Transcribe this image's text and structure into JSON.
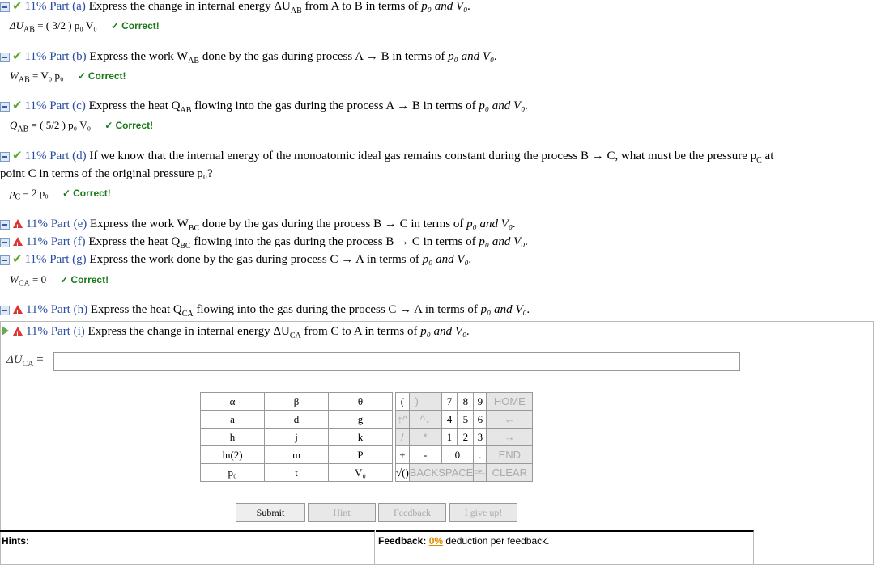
{
  "parts": [
    {
      "pct": "11% Part (a)",
      "question": "Express the change in internal energy ΔU",
      "sub": "AB",
      "question2": " from A to B in terms of ",
      "status": "correct",
      "answer_lhs": "ΔU",
      "answer_sub": "AB",
      "answer_rhs": " = ( 3/2 ) p₀ V₀",
      "feedback": "Correct!"
    },
    {
      "pct": "11% Part (b)",
      "question": "Express the work W",
      "sub": "AB",
      "question2": " done by the gas during process A → B in terms of ",
      "status": "correct",
      "answer_lhs": "W",
      "answer_sub": "AB",
      "answer_rhs": " = V₀ p₀",
      "feedback": "Correct!"
    },
    {
      "pct": "11% Part (c)",
      "question": "Express the heat Q",
      "sub": "AB",
      "question2": " flowing into the gas during the process A → B in terms of ",
      "status": "correct",
      "answer_lhs": "Q",
      "answer_sub": "AB",
      "answer_rhs": " = ( 5/2 ) p₀ V₀",
      "feedback": "Correct!"
    },
    {
      "pct": "11% Part (d)",
      "question": "If we know that the internal energy of the monoatomic ideal gas remains constant during the process B → C, what must be the pressure p",
      "sub": "C",
      "question2": " at",
      "line2": "point C in terms of the original pressure p₀?",
      "status": "correct",
      "answer_lhs": "p",
      "answer_sub": "C",
      "answer_rhs": " = 2 p₀",
      "feedback": "Correct!"
    },
    {
      "pct": "11% Part (e)",
      "question": "Express the work W",
      "sub": "BC",
      "question2": " done by the gas during the process B → C in terms of ",
      "status": "warn"
    },
    {
      "pct": "11% Part (f)",
      "question": "Express the heat Q",
      "sub": "BC",
      "question2": " flowing into the gas during the process B → C in terms of ",
      "status": "warn"
    },
    {
      "pct": "11% Part (g)",
      "question": "Express the work done by the gas during process C → A in terms of ",
      "sub": "",
      "question2": "",
      "status": "correct",
      "answer_lhs": "W",
      "answer_sub": "CA",
      "answer_rhs": " = 0",
      "feedback": "Correct!"
    },
    {
      "pct": "11% Part (h)",
      "question": "Express the heat Q",
      "sub": "CA",
      "question2": " flowing into the gas during the process C → A in terms of ",
      "status": "warn"
    },
    {
      "pct": "11% Part (i)",
      "question": "Express the change in internal energy ΔU",
      "sub": "CA",
      "question2": " from C to A in terms of ",
      "status": "active"
    }
  ],
  "terms_suffix": "p₀ and V₀.",
  "input_label": "ΔU",
  "input_label_sub": "CA",
  "input_label_eq": " =",
  "keypad": {
    "vars": [
      [
        "α",
        "β",
        "θ"
      ],
      [
        "a",
        "d",
        "g"
      ],
      [
        "h",
        "j",
        "k"
      ],
      [
        "ln(2)",
        "m",
        "P"
      ],
      [
        "p₀",
        "t",
        "V₀"
      ]
    ],
    "ops": [
      [
        "(",
        ")"
      ],
      [
        "↑^",
        "^↓"
      ],
      [
        "/",
        "*"
      ],
      [
        "+",
        "-"
      ],
      [
        "√()",
        "BACKSPACE"
      ]
    ],
    "nums": [
      [
        "7",
        "8",
        "9"
      ],
      [
        "4",
        "5",
        "6"
      ],
      [
        "1",
        "2",
        "3"
      ],
      [
        "0",
        "."
      ]
    ],
    "nav": [
      "HOME",
      "←",
      "→",
      "END",
      "CLEAR"
    ],
    "del": "DEL"
  },
  "buttons": {
    "submit": "Submit",
    "hint": "Hint",
    "feedback": "Feedback",
    "give_up": "I give up!"
  },
  "hints_label": "Hints:",
  "feedback_label": "Feedback:",
  "feedback_pct": "0%",
  "feedback_text": " deduction per feedback."
}
